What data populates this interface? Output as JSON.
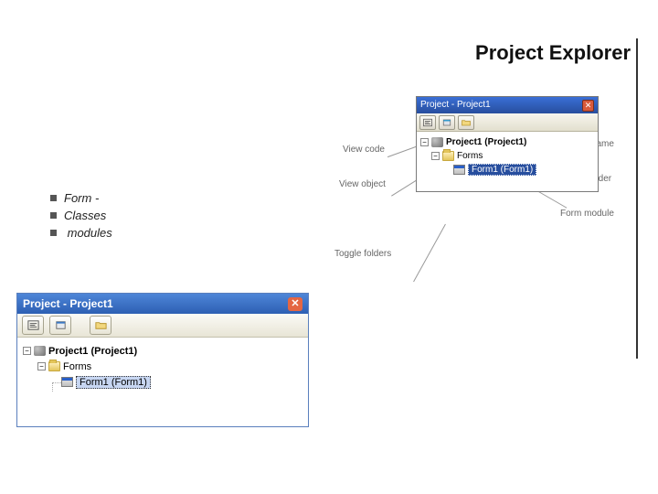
{
  "slide_title": "Project Explorer",
  "bullets": [
    "Form -",
    "Classes",
    " modules"
  ],
  "annotations": {
    "view_code": "View code",
    "view_object": "View object",
    "toggle_folders": "Toggle folders",
    "project_name": "Project name",
    "forms_folder": "Forms folder",
    "form_module": "Form module"
  },
  "mini_explorer": {
    "title": "Project - Project1",
    "project_node": "Project1 (Project1)",
    "forms_node": "Forms",
    "form_node": "Form1 (Form1)"
  },
  "explorer": {
    "title": "Project - Project1",
    "project_node": "Project1 (Project1)",
    "forms_node": "Forms",
    "form_node": "Form1 (Form1)"
  }
}
